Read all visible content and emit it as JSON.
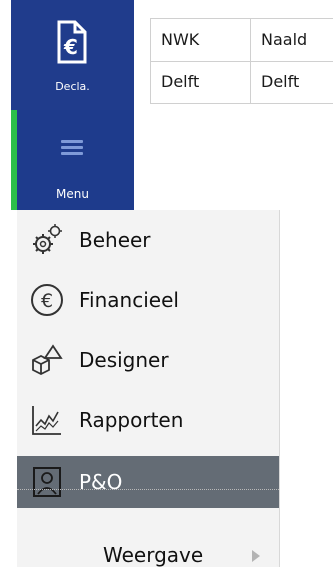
{
  "nav": {
    "decla_label": "Decla.",
    "decla_icon": "euro-document-icon",
    "menu_label": "Menu",
    "menu_icon": "hamburger-icon",
    "accent_color": "#2bbf4a",
    "bg_color": "#203c8c"
  },
  "table": {
    "rows": [
      {
        "code": "NWK",
        "name": "Naald"
      },
      {
        "code": "Delft",
        "name": "Delft"
      }
    ]
  },
  "menu": {
    "items": [
      {
        "label": "Beheer",
        "icon": "gears-icon"
      },
      {
        "label": "Financieel",
        "icon": "euro-circle-icon"
      },
      {
        "label": "Designer",
        "icon": "shapes-icon"
      },
      {
        "label": "Rapporten",
        "icon": "chart-icon"
      },
      {
        "label": "P&O",
        "icon": "person-icon"
      }
    ],
    "selected": "P&O",
    "submenu": {
      "label": "Weergave",
      "icon": "chevron-right-icon"
    }
  }
}
